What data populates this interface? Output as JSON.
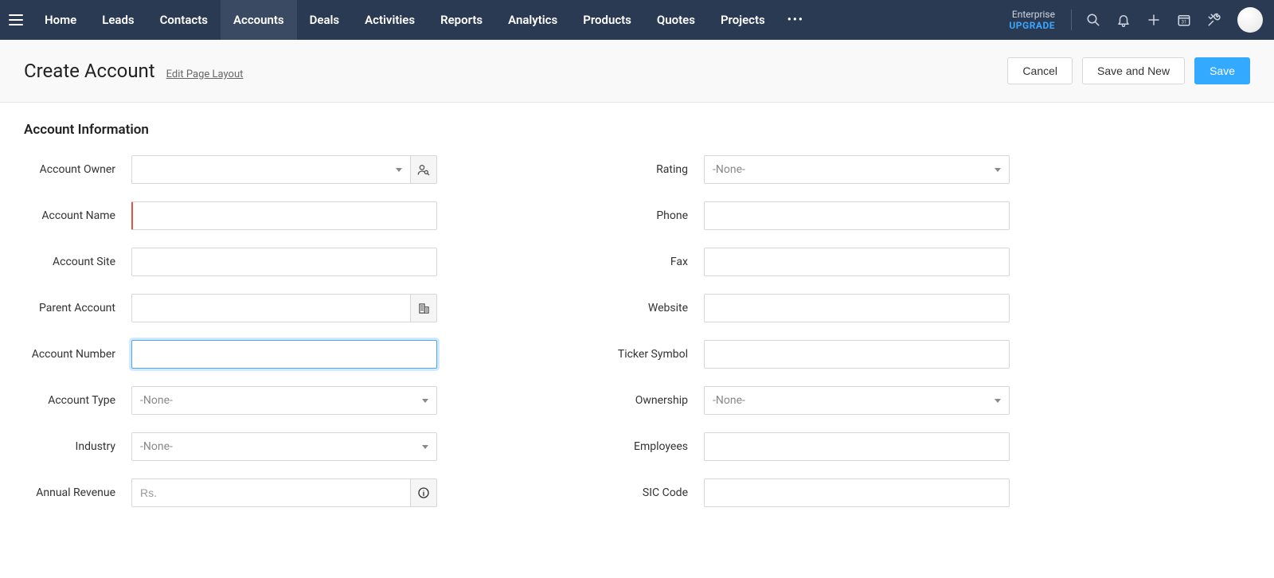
{
  "topbar": {
    "plan_label": "Enterprise",
    "upgrade_label": "UPGRADE",
    "calendar_day": "31",
    "tabs": [
      {
        "label": "Home"
      },
      {
        "label": "Leads"
      },
      {
        "label": "Contacts"
      },
      {
        "label": "Accounts",
        "active": true
      },
      {
        "label": "Deals"
      },
      {
        "label": "Activities"
      },
      {
        "label": "Reports"
      },
      {
        "label": "Analytics"
      },
      {
        "label": "Products"
      },
      {
        "label": "Quotes"
      },
      {
        "label": "Projects"
      }
    ],
    "more_label": "•••"
  },
  "page": {
    "title": "Create Account",
    "edit_layout_label": "Edit Page Layout",
    "actions": {
      "cancel": "Cancel",
      "save_and_new": "Save and New",
      "save": "Save"
    }
  },
  "form": {
    "section_title": "Account Information",
    "none_placeholder": "-None-",
    "left": {
      "account_owner": {
        "label": "Account Owner",
        "value": ""
      },
      "account_name": {
        "label": "Account Name",
        "value": ""
      },
      "account_site": {
        "label": "Account Site",
        "value": ""
      },
      "parent_account": {
        "label": "Parent Account",
        "value": ""
      },
      "account_number": {
        "label": "Account Number",
        "value": ""
      },
      "account_type": {
        "label": "Account Type",
        "value": "-None-"
      },
      "industry": {
        "label": "Industry",
        "value": "-None-"
      },
      "annual_revenue": {
        "label": "Annual Revenue",
        "placeholder": "Rs.",
        "value": ""
      }
    },
    "right": {
      "rating": {
        "label": "Rating",
        "value": "-None-"
      },
      "phone": {
        "label": "Phone",
        "value": ""
      },
      "fax": {
        "label": "Fax",
        "value": ""
      },
      "website": {
        "label": "Website",
        "value": ""
      },
      "ticker_symbol": {
        "label": "Ticker Symbol",
        "value": ""
      },
      "ownership": {
        "label": "Ownership",
        "value": "-None-"
      },
      "employees": {
        "label": "Employees",
        "value": ""
      },
      "sic_code": {
        "label": "SIC Code",
        "value": ""
      }
    }
  }
}
